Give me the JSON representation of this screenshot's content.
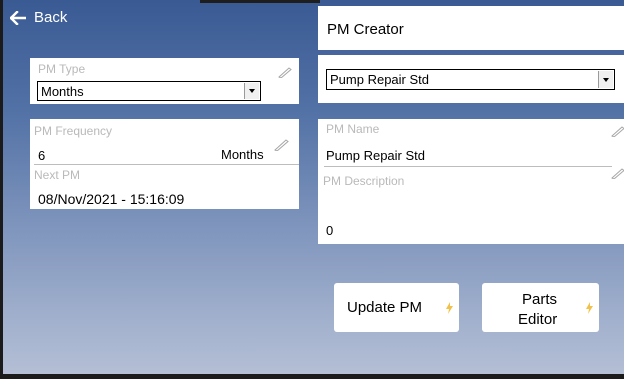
{
  "header": {
    "back_label": "Back"
  },
  "left": {
    "pm_type": {
      "label": "PM Type",
      "selected": "Months"
    },
    "pm_frequency": {
      "label": "PM Frequency",
      "value": "6",
      "unit": "Months"
    },
    "next_pm": {
      "label": "Next PM",
      "value": "08/Nov/2021 - 15:16:09"
    }
  },
  "right": {
    "title": "PM Creator",
    "template_select": {
      "selected": "Pump Repair Std"
    },
    "pm_name": {
      "label": "PM Name",
      "value": "Pump Repair Std"
    },
    "pm_description": {
      "label": "PM Description",
      "value": "0"
    }
  },
  "buttons": {
    "update_pm": "Update PM",
    "parts_editor_line1": "Parts",
    "parts_editor_line2": "Editor"
  },
  "colors": {
    "accent_bolt": "#f0c24b",
    "label_gray": "#b9b9b9"
  },
  "icons": [
    "arrow-left-icon",
    "pencil-icon",
    "bolt-icon",
    "chevron-down-icon"
  ]
}
